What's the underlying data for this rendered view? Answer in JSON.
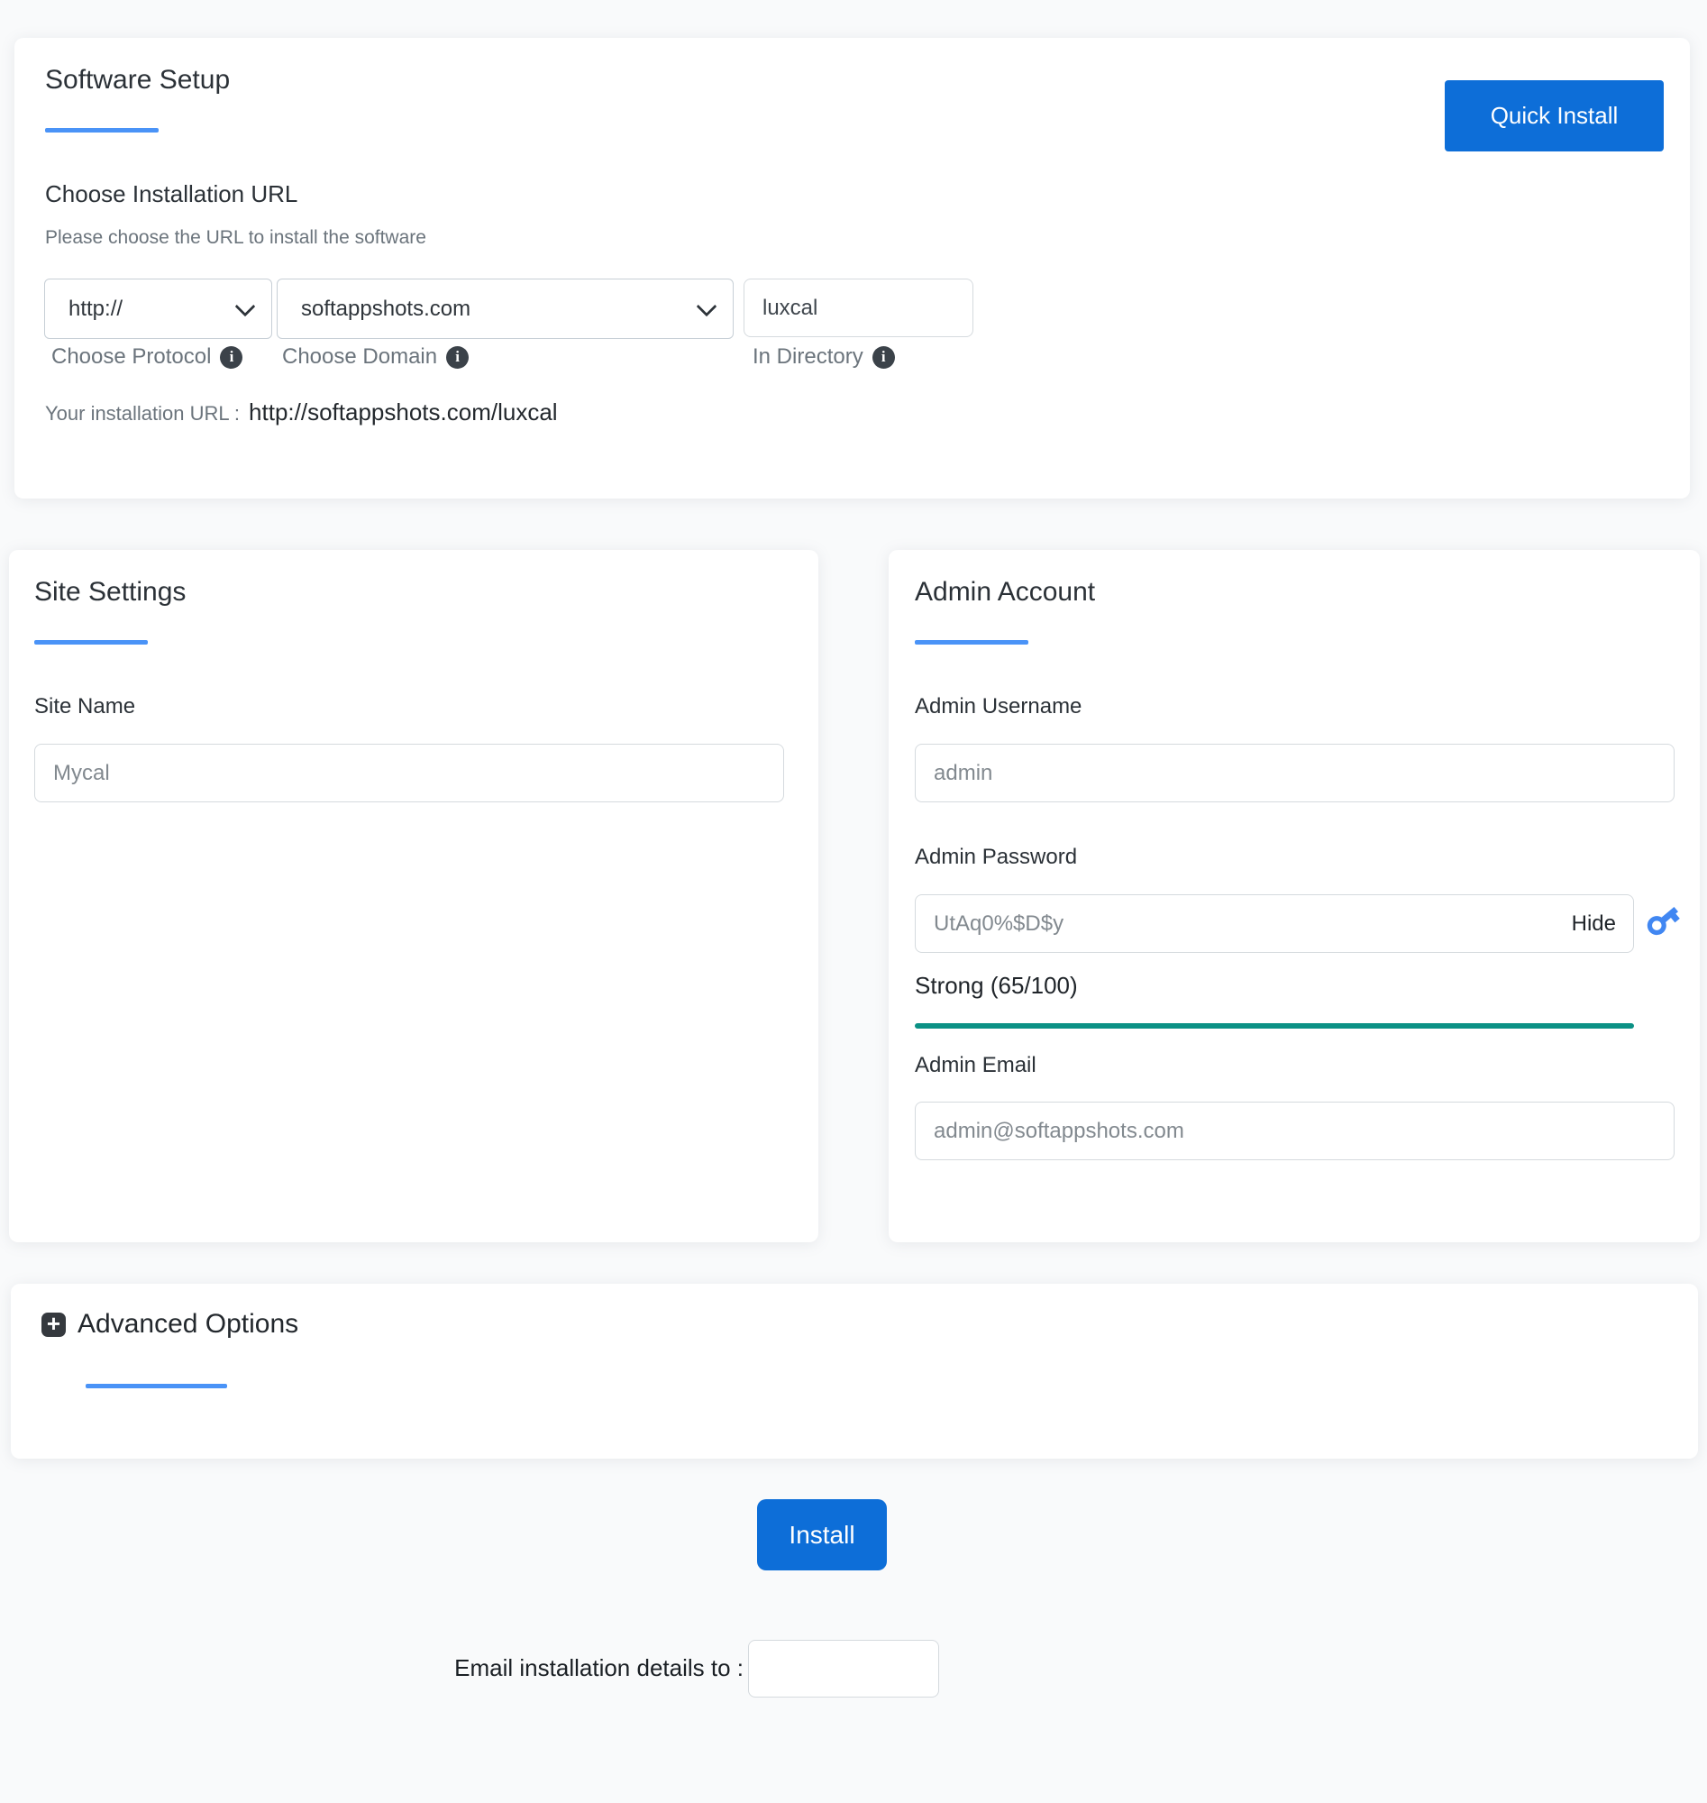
{
  "software_setup": {
    "title": "Software Setup",
    "quick_install_label": "Quick Install",
    "section_title": "Choose Installation URL",
    "section_subtitle": "Please choose the URL to install the software",
    "protocol": {
      "value": "http://",
      "label": "Choose Protocol"
    },
    "domain": {
      "value": "softappshots.com",
      "label": "Choose Domain"
    },
    "directory": {
      "value": "luxcal",
      "label": "In Directory"
    },
    "installation_url_label": "Your installation URL :",
    "installation_url": "http://softappshots.com/luxcal"
  },
  "site_settings": {
    "title": "Site Settings",
    "site_name_label": "Site Name",
    "site_name_value": "Mycal"
  },
  "admin_account": {
    "title": "Admin Account",
    "username_label": "Admin Username",
    "username_value": "admin",
    "password_label": "Admin Password",
    "password_value": "UtAq0%$D$y",
    "hide_label": "Hide",
    "strength_text": "Strong (65/100)",
    "strength_percent": 100,
    "email_label": "Admin Email",
    "email_value": "admin@softappshots.com"
  },
  "advanced_options": {
    "title": "Advanced Options"
  },
  "footer": {
    "install_label": "Install",
    "email_details_label": "Email installation details to :",
    "email_value": ""
  },
  "colors": {
    "primary_blue": "#0d6ed8",
    "accent_blue": "#4a93f7",
    "strength_teal": "#0b9185",
    "info_icon_dark": "#3b4249"
  }
}
